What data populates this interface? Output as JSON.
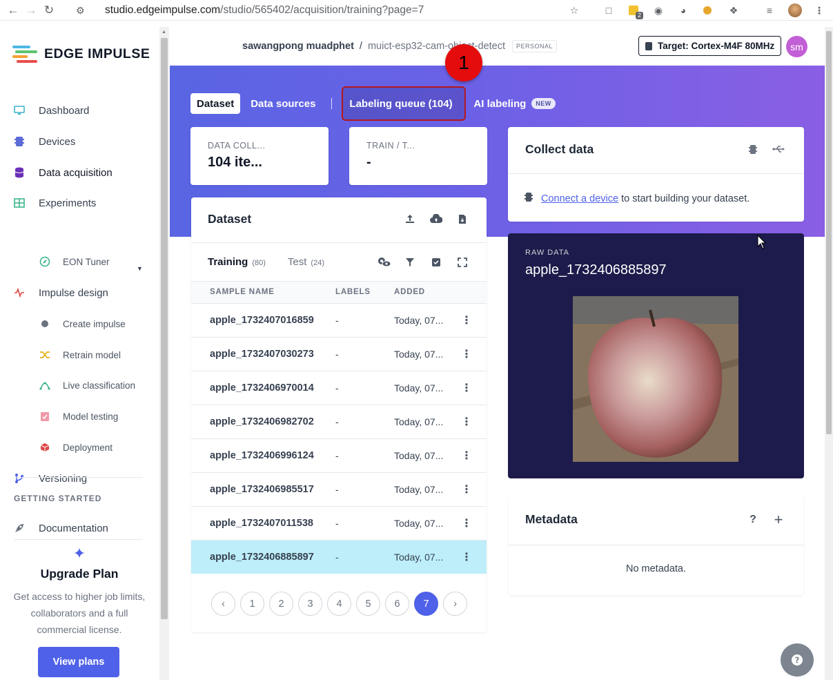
{
  "browser": {
    "url_host": "studio.edgeimpulse.com",
    "url_path": "/studio/565402/acquisition/training?page=7",
    "ext_badge": "2"
  },
  "sidebar": {
    "brand": "EDGE IMPULSE",
    "items": [
      {
        "label": "Dashboard"
      },
      {
        "label": "Devices"
      },
      {
        "label": "Data acquisition"
      },
      {
        "label": "Experiments"
      },
      {
        "label": "EON Tuner"
      },
      {
        "label": "Impulse design"
      },
      {
        "label": "Create impulse"
      },
      {
        "label": "Retrain model"
      },
      {
        "label": "Live classification"
      },
      {
        "label": "Model testing"
      },
      {
        "label": "Deployment"
      },
      {
        "label": "Versioning"
      }
    ],
    "section_label": "GETTING STARTED",
    "doc_label": "Documentation",
    "upgrade": {
      "title": "Upgrade Plan",
      "text": "Get access to higher job limits, collaborators and a full commercial license.",
      "button": "View plans"
    }
  },
  "header": {
    "user": "sawangpong muadphet",
    "separator": "/",
    "project": "muict-esp32-cam-object-detect",
    "badge": "PERSONAL",
    "target": "Target: Cortex-M4F 80MHz",
    "avatar": "sm"
  },
  "tabs": {
    "dataset": "Dataset",
    "sources": "Data sources",
    "queue": "Labeling queue (104)",
    "ai": "AI labeling",
    "new_badge": "NEW"
  },
  "annotation": {
    "step": "1"
  },
  "stats": {
    "collected_label": "DATA COLL...",
    "collected_value": "104 ite...",
    "split_label": "TRAIN / T...",
    "split_value": "-"
  },
  "dataset": {
    "title": "Dataset",
    "training_tab": "Training",
    "training_count": "(80)",
    "test_tab": "Test",
    "test_count": "(24)",
    "columns": [
      "SAMPLE NAME",
      "LABELS",
      "ADDED"
    ],
    "rows": [
      {
        "name": "apple_1732407016859",
        "labels": "-",
        "added": "Today, 07..."
      },
      {
        "name": "apple_1732407030273",
        "labels": "-",
        "added": "Today, 07..."
      },
      {
        "name": "apple_1732406970014",
        "labels": "-",
        "added": "Today, 07..."
      },
      {
        "name": "apple_1732406982702",
        "labels": "-",
        "added": "Today, 07..."
      },
      {
        "name": "apple_1732406996124",
        "labels": "-",
        "added": "Today, 07..."
      },
      {
        "name": "apple_1732406985517",
        "labels": "-",
        "added": "Today, 07..."
      },
      {
        "name": "apple_1732407011538",
        "labels": "-",
        "added": "Today, 07..."
      },
      {
        "name": "apple_1732406885897",
        "labels": "-",
        "added": "Today, 07..."
      }
    ],
    "selected_row": 7,
    "pages": [
      "1",
      "2",
      "3",
      "4",
      "5",
      "6",
      "7"
    ],
    "current_page": "7"
  },
  "collect": {
    "title": "Collect data",
    "link": "Connect a device",
    "text": " to start building your dataset."
  },
  "raw": {
    "label": "RAW DATA",
    "title": "apple_1732406885897"
  },
  "metadata": {
    "title": "Metadata",
    "empty": "No metadata."
  },
  "colors": {
    "accent": "#4f61e8",
    "hero_start": "#5965e3",
    "hero_end": "#8a5fe4",
    "raw_bg": "#1c1b4b",
    "selected_row": "#bdeef9",
    "highlight_box": "#b3181e",
    "step_marker": "#e40c0c"
  }
}
